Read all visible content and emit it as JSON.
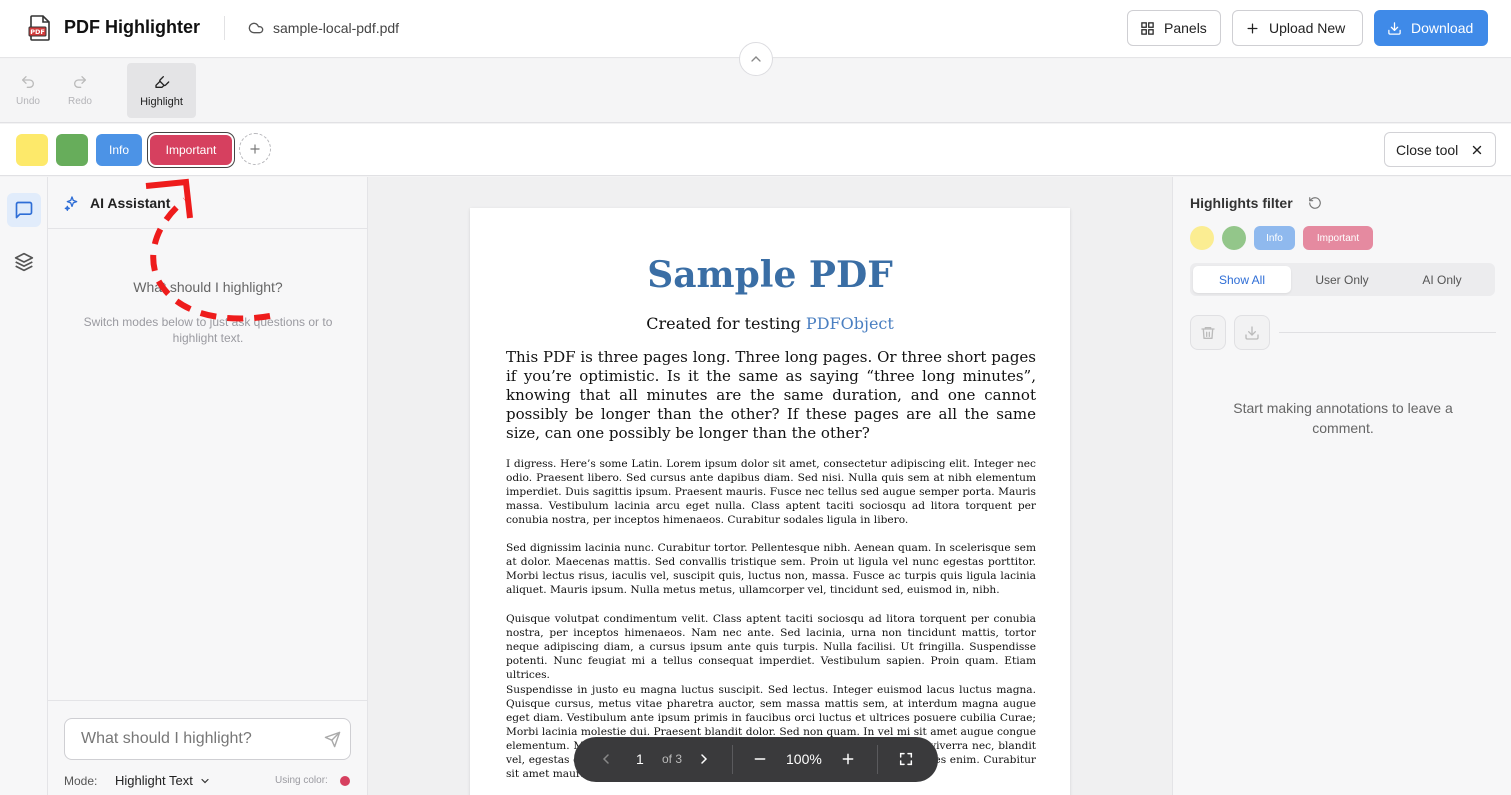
{
  "header": {
    "app_title": "PDF Highlighter",
    "file_name": "sample-local-pdf.pdf",
    "panels_label": "Panels",
    "upload_label": "Upload New",
    "download_label": "Download"
  },
  "toolbar": {
    "undo_label": "Undo",
    "redo_label": "Redo",
    "highlight_label": "Highlight"
  },
  "colors": {
    "items": [
      {
        "label": "",
        "color": "#fde96a"
      },
      {
        "label": "",
        "color": "#67ad5b"
      },
      {
        "label": "Info",
        "color": "#4c93e6"
      },
      {
        "label": "Important",
        "color": "#d6405f"
      }
    ],
    "selected": "Important",
    "close_tool_label": "Close tool"
  },
  "ai_panel": {
    "title": "AI Assistant",
    "empty_title": "What should I highlight?",
    "empty_subtitle": "Switch modes below to just ask questions or to highlight text.",
    "input_placeholder": "What should I highlight?",
    "mode_label": "Mode:",
    "mode_value": "Highlight Text",
    "using_color_label": "Using color:"
  },
  "document": {
    "title": "Sample PDF",
    "subtitle_prefix": "Created for testing",
    "subtitle_link": "PDFObject",
    "lead": "This PDF is three pages long. Three long pages. Or three short pages if you’re optimistic. Is it the same as saying “three long minutes”, knowing that all minutes are the same duration, and one cannot possibly be longer than the other? If these pages are all the same size, can one possibly be longer than the other?",
    "paragraphs": [
      "I digress. Here’s some Latin. Lorem ipsum dolor sit amet, consectetur adipiscing elit. Integer nec odio. Praesent libero. Sed cursus ante dapibus diam. Sed nisi. Nulla quis sem at nibh elementum imperdiet. Duis sagittis ipsum. Praesent mauris. Fusce nec tellus sed augue semper porta. Mauris massa. Vestibulum lacinia arcu eget nulla. Class aptent taciti sociosqu ad litora torquent per conubia nostra, per inceptos himenaeos. Curabitur sodales ligula in libero.",
      "Sed dignissim lacinia nunc. Curabitur tortor. Pellentesque nibh. Aenean quam. In scelerisque sem at dolor. Maecenas mattis. Sed convallis tristique sem. Proin ut ligula vel nunc egestas porttitor. Morbi lectus risus, iaculis vel, suscipit quis, luctus non, massa. Fusce ac turpis quis ligula lacinia aliquet. Mauris ipsum. Nulla metus metus, ullamcorper vel, tincidunt sed, euismod in, nibh.",
      "Quisque volutpat condimentum velit. Class aptent taciti sociosqu ad litora torquent per conubia nostra, per inceptos himenaeos. Nam nec ante. Sed lacinia, urna non tincidunt mattis, tortor neque adipiscing diam, a cursus ipsum ante quis turpis. Nulla facilisi. Ut fringilla. Suspendisse potenti. Nunc feugiat mi a tellus consequat imperdiet. Vestibulum sapien. Proin quam. Etiam ultrices.",
      "Suspendisse in justo eu magna luctus suscipit. Sed lectus. Integer euismod lacus luctus magna. Quisque cursus, metus vitae pharetra auctor, sem massa mattis sem, at interdum magna augue eget diam. Vestibulum ante ipsum primis in faucibus orci luctus et ultrices posuere cubilia Curae; Morbi lacinia molestie dui. Praesent blandit dolor. Sed non quam. In vel mi sit amet augue congue elementum. Morbi in ipsum sit amet pede facilisis laoreet. Donec lacus nunc, viverra nec, blandit vel, egestas et, augue. Vestibulum tincidunt malesuada tellus. Ut ultrices ultrices enim. Curabitur sit amet mauris."
    ]
  },
  "pager": {
    "page": "1",
    "of_label": "of 3",
    "zoom": "100%"
  },
  "highlights_filter": {
    "title": "Highlights filter",
    "chips": [
      "Info",
      "Important"
    ],
    "tabs": [
      "Show All",
      "User Only",
      "AI Only"
    ],
    "active_tab": "Show All",
    "empty_message": "Start making annotations to leave a comment."
  }
}
